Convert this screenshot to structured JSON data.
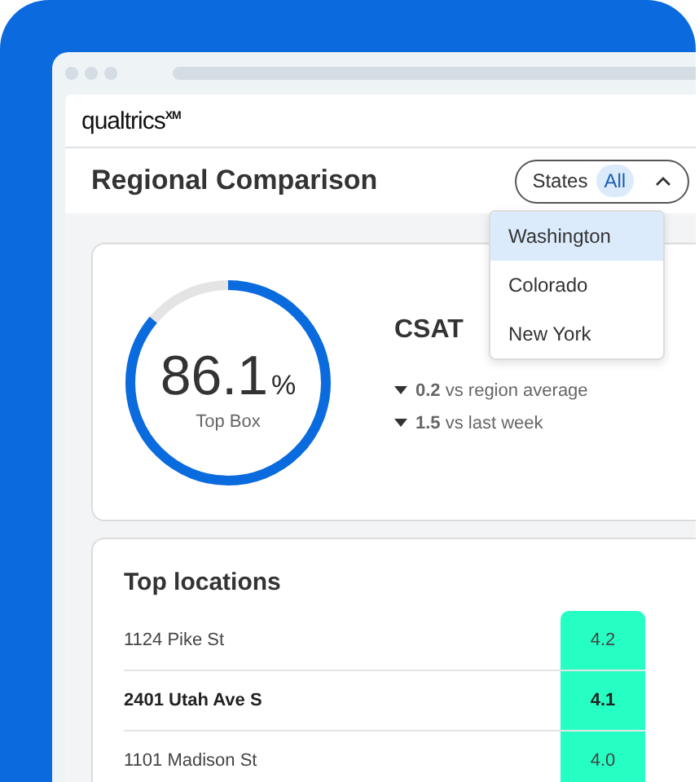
{
  "app": {
    "logo": "qualtrics$^{XM}$"
  },
  "header": {
    "title": "Regional Comparison",
    "filter": {
      "label": "States",
      "value": "All",
      "expanded": true
    },
    "options": [
      {
        "label": "Washington",
        "selected": true
      },
      {
        "label": "Colorado",
        "selected": false
      },
      {
        "label": "New York",
        "selected": false
      }
    ]
  },
  "metric": {
    "value": "86.1",
    "unit": "%",
    "caption": "Top Box",
    "level": 0.861,
    "title": "CSAT",
    "deltas": [
      {
        "text": "**0.2** vs region average",
        "decrease": true
      },
      {
        "text": "**1.5** vs last week",
        "decrease": true
      }
    ]
  },
  "locations": {
    "title": "Top locations",
    "rows": [
      {
        "name": "1124 Pike St",
        "score": "4.2",
        "emphasized": false
      },
      {
        "name": "2401 Utah Ave S",
        "score": "4.1",
        "emphasized": true
      },
      {
        "name": "1101 Madison St",
        "score": "4.0",
        "emphasized": false
      }
    ]
  }
}
